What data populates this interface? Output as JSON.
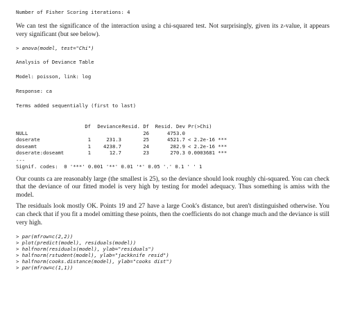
{
  "fisher_line": "Number of Fisher Scoring iterations: 4",
  "para1": "We can test the significance of the interaction using a chi-squared test. Not surprisingly, given its z-value, it appears very significant (but see below).",
  "cmd_anova": "> anova(model, test=\"Chi\")",
  "anova_title": "Analysis of Deviance Table",
  "model_line": "Model: poisson, link: log",
  "response_line": "Response: ca",
  "terms_line": "Terms added sequentially (first to last)",
  "table": {
    "headers": [
      "",
      "Df",
      "Deviance",
      "Resid. Df",
      "Resid. Dev",
      "Pr(>Chi)"
    ],
    "rows": [
      {
        "term": "NULL",
        "df": "",
        "deviance": "",
        "resid_df": "26",
        "resid_dev": "4753.0",
        "p": ""
      },
      {
        "term": "doserate",
        "df": "1",
        "deviance": "231.3",
        "resid_df": "25",
        "resid_dev": "4521.7",
        "p": "< 2.2e-16 ***"
      },
      {
        "term": "doseamt",
        "df": "1",
        "deviance": "4238.7",
        "resid_df": "24",
        "resid_dev": "282.9",
        "p": "< 2.2e-16 ***"
      },
      {
        "term": "doserate:doseamt",
        "df": "1",
        "deviance": "12.7",
        "resid_df": "23",
        "resid_dev": "270.3",
        "p": "0.0003681 ***"
      }
    ]
  },
  "sep_line": "---",
  "signif_line": "Signif. codes:  0 '***' 0.001 '**' 0.01 '*' 0.05 '.' 0.1 ' ' 1",
  "para2": "Our counts ca are reasonably large (the smallest is 25), so the deviance should look roughly chi-squared. You can check that the deviance of our fitted model is very high by testing for model adequacy. Thus something is amiss with the model.",
  "para3": "The residuals look mostly OK. Points 19 and 27 have a large Cook's distance, but aren't distinguished otherwise. You can check that if you fit a model omitting these points, then the coefficients do not change much and the deviance is still very high.",
  "commands": [
    "> par(mfrow=c(2,2))",
    "> plot(predict(model), residuals(model))",
    "> halfnorm(residuals(model), ylab=\"residuals\")",
    "> halfnorm(rstudent(model), ylab=\"jackknife resid\")",
    "> halfnorm(cooks.distance(model), ylab=\"cooks dist\")",
    "> par(mfrow=c(1,1))"
  ]
}
